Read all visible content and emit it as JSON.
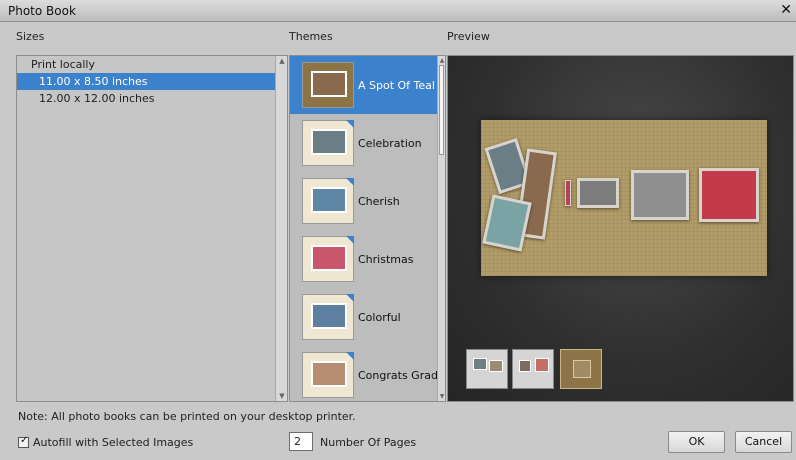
{
  "window": {
    "title": "Photo Book"
  },
  "sizes": {
    "label": "Sizes",
    "rows": [
      {
        "text": "Print locally",
        "kind": "group",
        "selected": false
      },
      {
        "text": "11.00 x 8.50 inches",
        "kind": "item",
        "selected": true
      },
      {
        "text": "12.00 x 12.00 inches",
        "kind": "item",
        "selected": false
      }
    ]
  },
  "themes": {
    "label": "Themes",
    "items": [
      {
        "label": "A Spot Of Teal",
        "selected": true
      },
      {
        "label": "Celebration",
        "selected": false
      },
      {
        "label": "Cherish",
        "selected": false
      },
      {
        "label": "Christmas",
        "selected": false
      },
      {
        "label": "Colorful",
        "selected": false
      },
      {
        "label": "Congrats Grad...",
        "selected": false
      }
    ]
  },
  "preview": {
    "label": "Preview",
    "page_thumbnails": 3,
    "active_thumbnail": 3
  },
  "note": "Note: All photo books can be printed on your desktop printer.",
  "autofill": {
    "label": "Autofill with Selected Images",
    "checked": true
  },
  "pages": {
    "value": "2",
    "label": "Number Of Pages"
  },
  "buttons": {
    "ok": "OK",
    "cancel": "Cancel"
  },
  "colors": {
    "selection": "#3c81cc",
    "preview_bg": "#2f2f2f",
    "page_tan": "#b29c69"
  }
}
